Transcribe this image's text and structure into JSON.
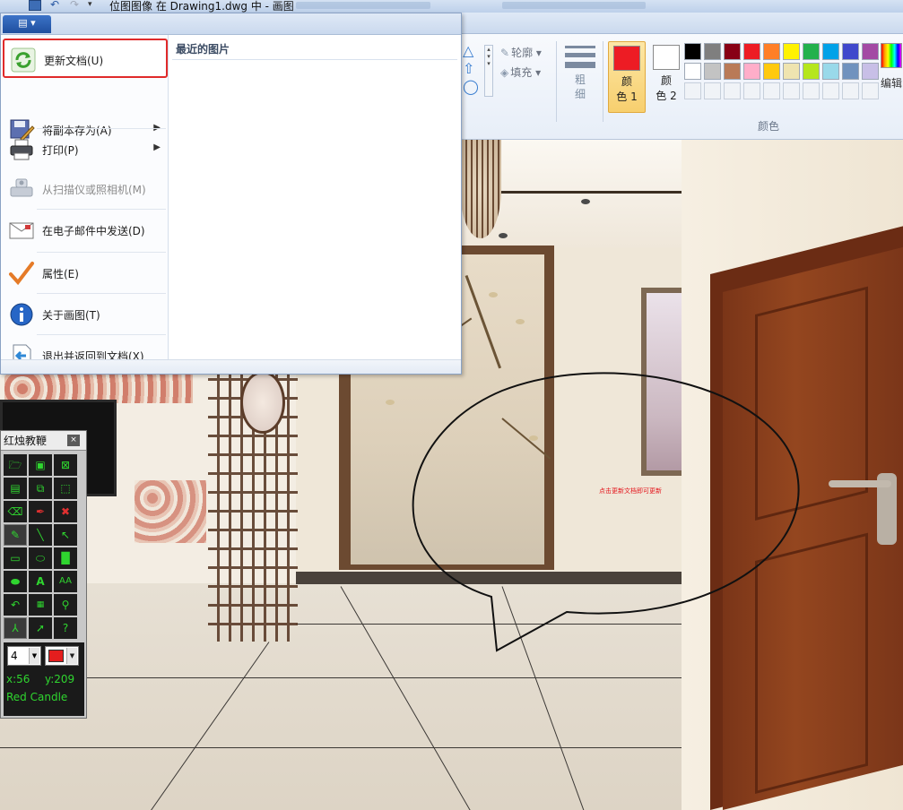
{
  "titlebar": {
    "title": "位图图像 在 Drawing1.dwg 中 - 画图"
  },
  "ribbon": {
    "outline_label": "轮廓",
    "fill_label": "填充",
    "size_label_1": "粗",
    "size_label_2": "细",
    "color1_line1": "颜",
    "color1_line2": "色 1",
    "color2_line1": "颜",
    "color2_line2": "色 2",
    "colors_group": "颜色",
    "edit_colors_label": "编辑",
    "color1_value": "#ed1c24",
    "color2_value": "#ffffff",
    "palette_row1": [
      "#000000",
      "#7f7f7f",
      "#880015",
      "#ed1c24",
      "#ff7f27",
      "#fff200",
      "#22b14c",
      "#00a2e8",
      "#3f48cc",
      "#a349a4"
    ],
    "palette_row2": [
      "#ffffff",
      "#c3c3c3",
      "#b97a57",
      "#ffaec9",
      "#ffc90e",
      "#efe4b0",
      "#b5e61d",
      "#99d9ea",
      "#7092be",
      "#c8bfe7"
    ]
  },
  "file_menu": {
    "items": [
      {
        "label": "更新文档(U)",
        "icon": "refresh-icon"
      },
      {
        "label": "将副本存为(A)",
        "icon": "save-as-icon"
      },
      {
        "label": "打印(P)",
        "icon": "printer-icon"
      },
      {
        "label": "从扫描仪或照相机(M)",
        "icon": "scanner-icon"
      },
      {
        "label": "在电子邮件中发送(D)",
        "icon": "email-icon"
      },
      {
        "label": "属性(E)",
        "icon": "checkmark-icon"
      },
      {
        "label": "关于画图(T)",
        "icon": "info-icon"
      },
      {
        "label": "退出并返回到文档(X)",
        "icon": "exit-return-icon"
      }
    ],
    "recent_title": "最近的图片"
  },
  "canvas": {
    "note_text": "点击更新文档即可更新"
  },
  "red_candle": {
    "title": "红烛教鞭",
    "close": "×",
    "pen_width": "4",
    "pen_color": "#e41e1e",
    "coord_x": "x:56",
    "coord_y": "y:209",
    "brand": "Red Candle"
  }
}
